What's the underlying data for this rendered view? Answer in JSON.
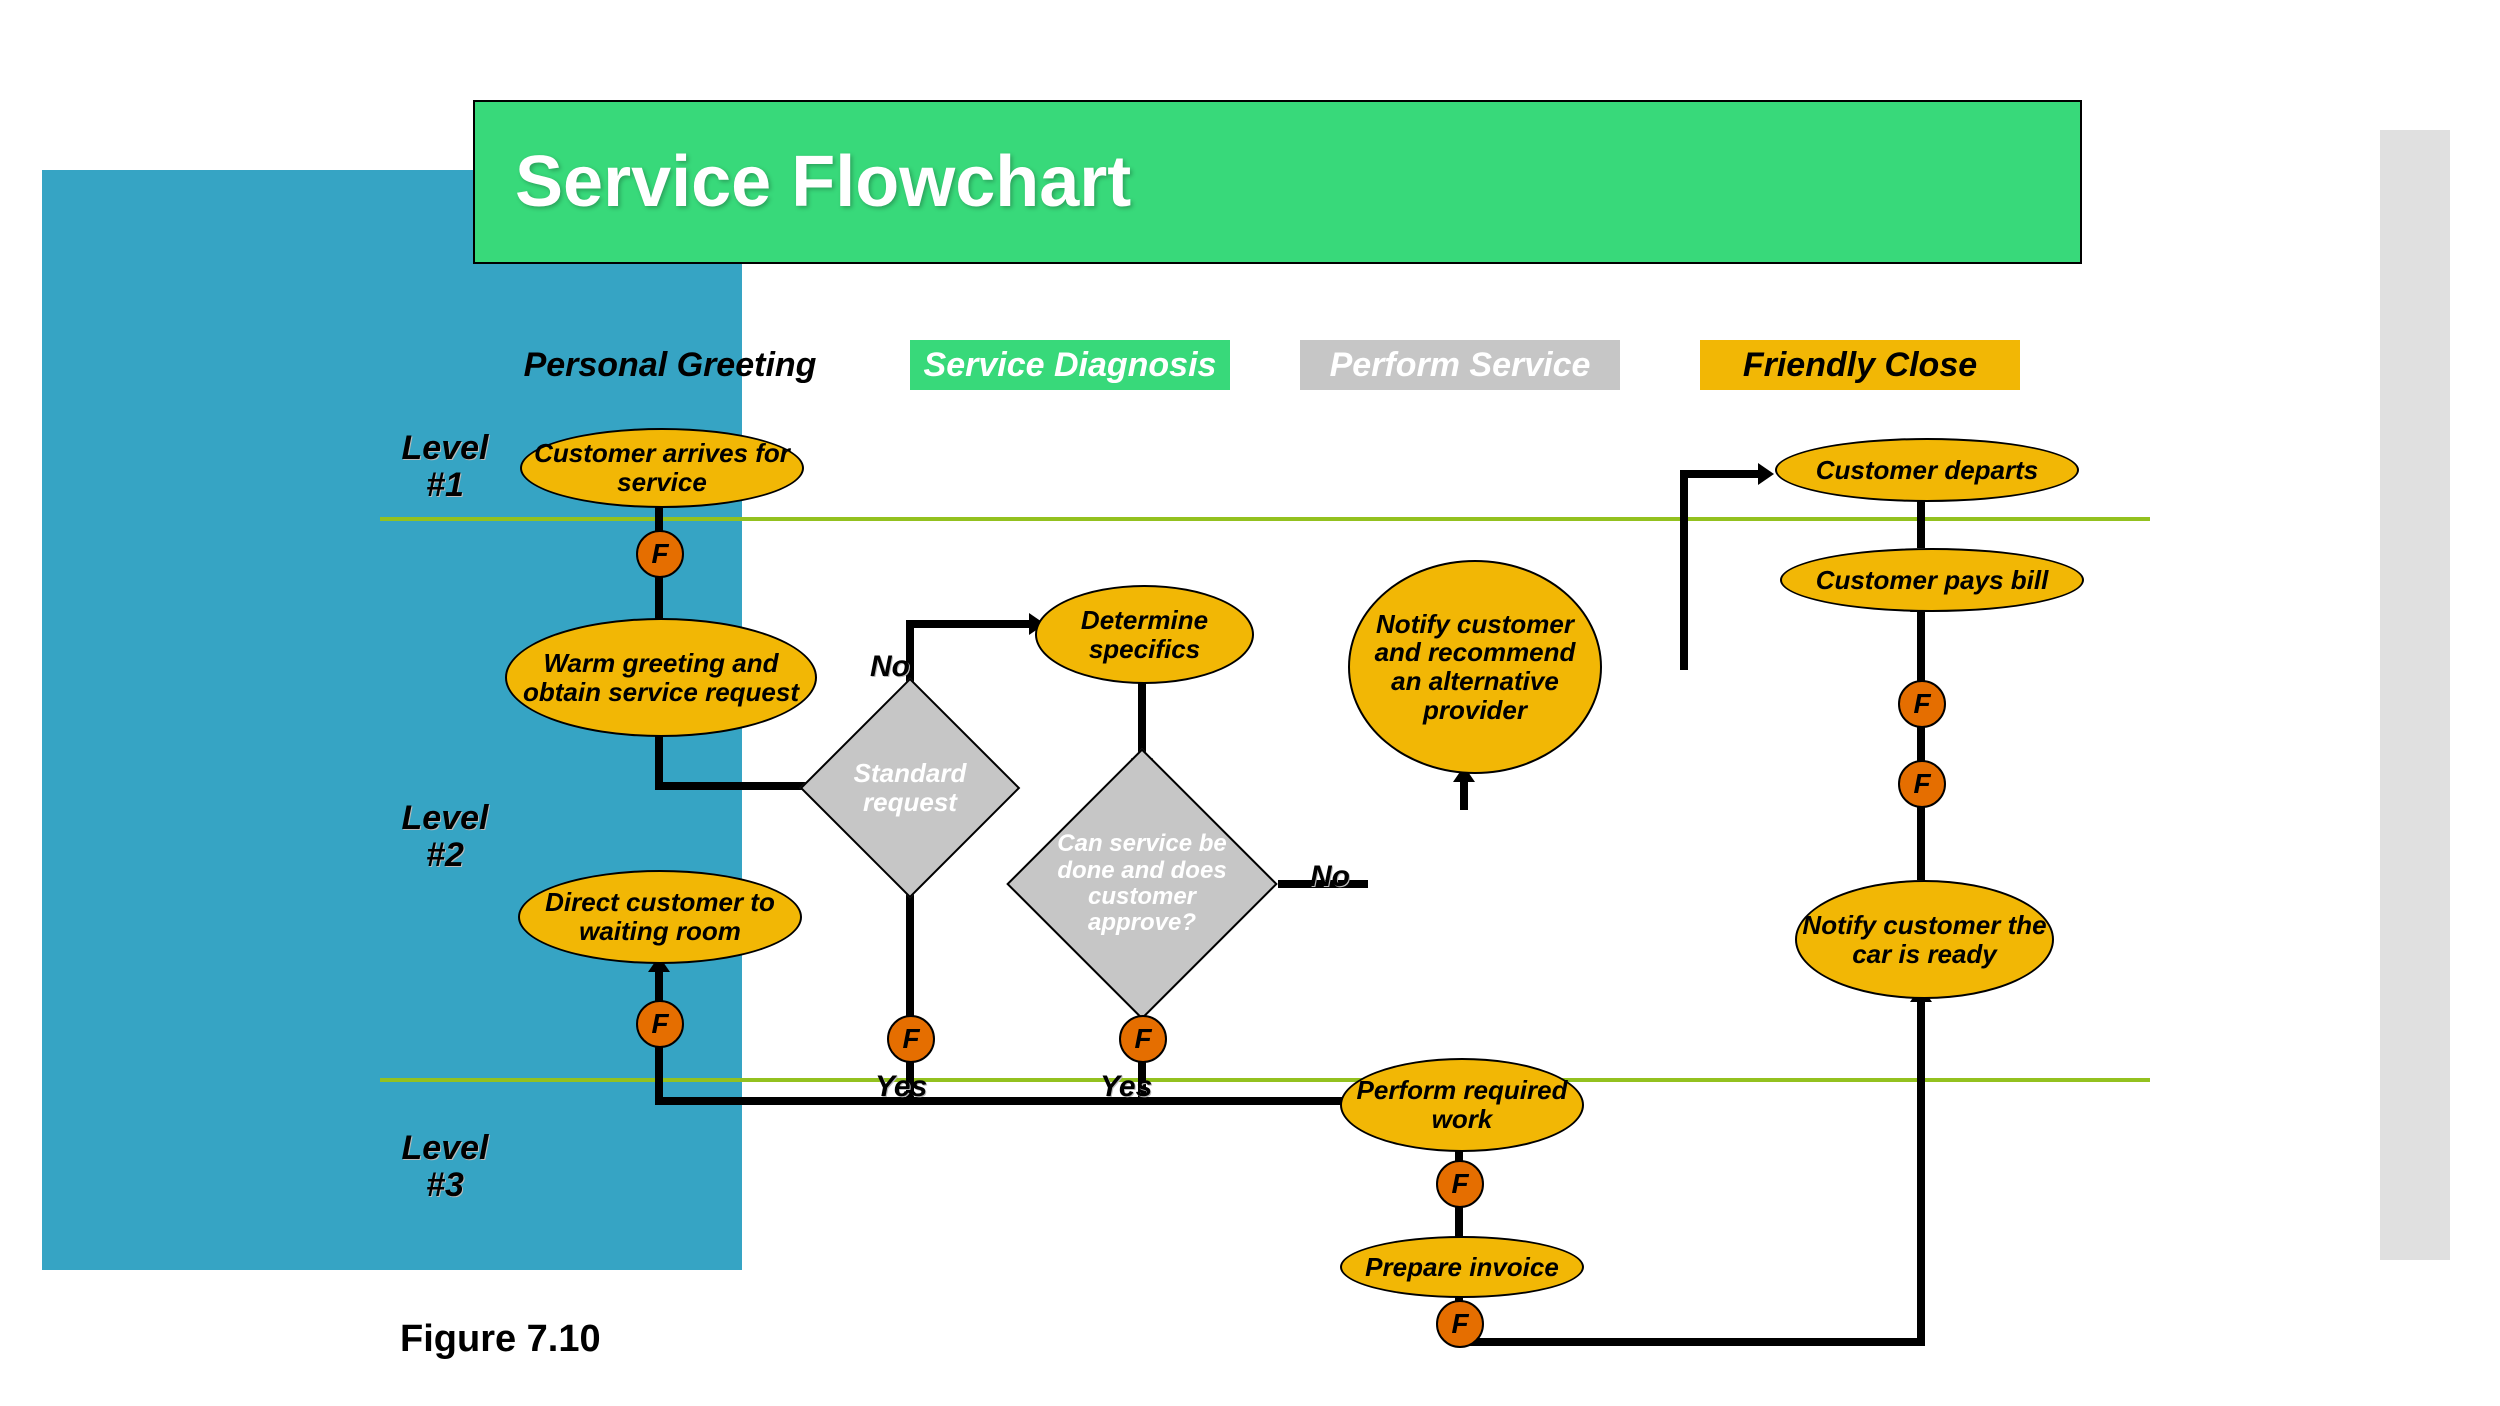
{
  "title": "Service Flowchart",
  "columns": {
    "c1": "Personal Greeting",
    "c2": "Service Diagnosis",
    "c3": "Perform Service",
    "c4": "Friendly Close"
  },
  "levels": {
    "l1": "Level #1",
    "l2": "Level #2",
    "l3": "Level #3"
  },
  "figure_caption": "Figure 7.10",
  "nodes": {
    "arrive": "Customer arrives for service",
    "greet": "Warm greeting and obtain service request",
    "direct": "Direct customer to waiting room",
    "standard": "Standard request",
    "determine": "Determine specifics",
    "canservice": "Can service be done and does customer approve?",
    "notify_alt": "Notify customer and recommend an alternative provider",
    "perform": "Perform required work",
    "invoice": "Prepare invoice",
    "notify_ready": "Notify customer the car is ready",
    "pays": "Customer pays bill",
    "departs": "Customer departs"
  },
  "decision_labels": {
    "no": "No",
    "yes": "Yes"
  },
  "fdot_label": "F"
}
